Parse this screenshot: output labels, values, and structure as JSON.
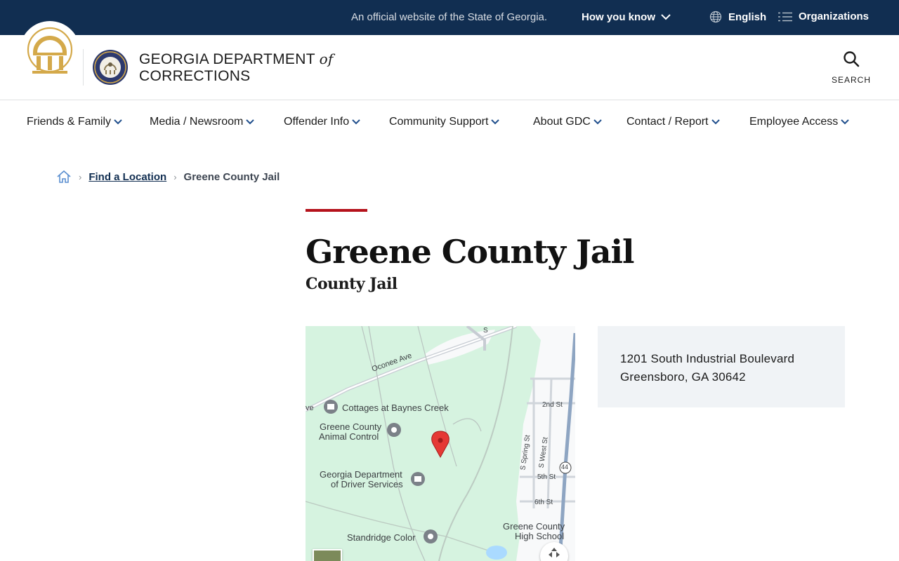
{
  "banner": {
    "official_text": "An official website of the State of Georgia.",
    "how_you_know": "How you know",
    "language": "English",
    "organizations": "Organizations"
  },
  "header": {
    "title_line1": "GEORGIA DEPARTMENT",
    "title_of": "of",
    "title_line2": "CORRECTIONS",
    "search_label": "SEARCH"
  },
  "nav": {
    "items": [
      {
        "label": "Friends & Family"
      },
      {
        "label": "Media / Newsroom"
      },
      {
        "label": "Offender Info"
      },
      {
        "label": "Community Support"
      },
      {
        "label": "About GDC"
      },
      {
        "label": "Contact / Report"
      },
      {
        "label": "Employee Access"
      }
    ]
  },
  "breadcrumb": {
    "home_icon": "home-icon",
    "link": "Find a Location",
    "current": "Greene County Jail"
  },
  "page": {
    "title": "Greene County Jail",
    "subtitle": "County Jail"
  },
  "map": {
    "labels": {
      "oconee": "Oconee Ave",
      "ave": "ve",
      "cottages": "Cottages at Baynes Creek",
      "animal1": "Greene County",
      "animal2": "Animal Control",
      "dds1": "Georgia Department",
      "dds2": "of Driver Services",
      "standridge": "Standridge Color",
      "school1": "Greene County",
      "school2": "High School",
      "second": "2nd St",
      "fifth": "5th St",
      "sixth": "6th St",
      "spring": "S Spring St",
      "west": "S West St",
      "hwy": "44",
      "s_top": "S"
    }
  },
  "address": {
    "line1": "1201 South Industrial Boulevard",
    "line2": "Greensboro, GA 30642"
  },
  "colors": {
    "banner_bg": "#112e51",
    "accent": "#b5121b",
    "map_bg": "#d6f3e0",
    "card_bg": "#f0f3f6"
  }
}
